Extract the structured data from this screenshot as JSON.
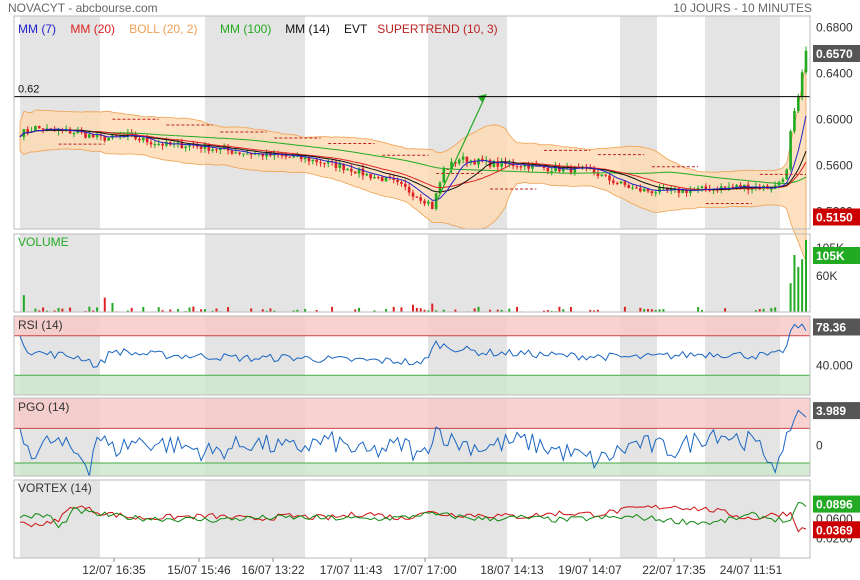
{
  "header": {
    "title": "NOVACYT - abcbourse.com",
    "period": "10 JOURS - 10 MINUTES"
  },
  "colors": {
    "mm7": "#2222cc",
    "mm20": "#dd2222",
    "boll": "#f0a050",
    "boll_fill": "#fcd9b0",
    "mm100": "#22aa22",
    "mm14": "#111111",
    "supertrend": "#bb2222",
    "weekend_band": "#e4e4e4",
    "rsi_high": "#f7c9c9",
    "rsi_low": "#cfe8cf",
    "indicator_line": "#1a66c2",
    "vortex_plus": "#118811",
    "vortex_minus": "#cc1111",
    "volume_up": "#22aa22",
    "volume_down": "#dd2222",
    "label_green": "#22aa22",
    "label_red": "#cc0000",
    "label_dark": "#555555"
  },
  "chart_data": [
    {
      "panel": "price",
      "type": "candlestick",
      "legend": [
        {
          "label": "MM (7)",
          "color": "#2222cc"
        },
        {
          "label": "MM (20)",
          "color": "#dd2222"
        },
        {
          "label": "BOLL (20, 2)",
          "color": "#f0a050"
        },
        {
          "label": "MM (100)",
          "color": "#22aa22"
        },
        {
          "label": "MM (14)",
          "color": "#111111"
        },
        {
          "label": "EVT",
          "color": "#111111"
        },
        {
          "label": "SUPERTREND (10, 3)",
          "color": "#bb2222"
        }
      ],
      "ylim": [
        0.505,
        0.69
      ],
      "yticks": [
        "0.6800",
        "0.6400",
        "0.6000",
        "0.5600",
        "0.5200"
      ],
      "hline": {
        "value": 0.62,
        "label": "0.62"
      },
      "last_label": "0.6570",
      "low_label": "0.5150",
      "close_path": [
        [
          0,
          0.588
        ],
        [
          4,
          0.593
        ],
        [
          8,
          0.59
        ],
        [
          12,
          0.59
        ],
        [
          16,
          0.588
        ],
        [
          20,
          0.584
        ],
        [
          24,
          0.584
        ],
        [
          28,
          0.586
        ],
        [
          32,
          0.582
        ],
        [
          38,
          0.578
        ],
        [
          44,
          0.578
        ],
        [
          50,
          0.575
        ],
        [
          56,
          0.572
        ],
        [
          62,
          0.57
        ],
        [
          68,
          0.568
        ],
        [
          74,
          0.566
        ],
        [
          80,
          0.562
        ],
        [
          86,
          0.557
        ],
        [
          90,
          0.552
        ],
        [
          96,
          0.547
        ],
        [
          100,
          0.54
        ],
        [
          104,
          0.532
        ],
        [
          106,
          0.528
        ],
        [
          107,
          0.524
        ],
        [
          110,
          0.556
        ],
        [
          114,
          0.566
        ],
        [
          118,
          0.564
        ],
        [
          124,
          0.561
        ],
        [
          130,
          0.561
        ],
        [
          136,
          0.558
        ],
        [
          142,
          0.557
        ],
        [
          148,
          0.556
        ],
        [
          152,
          0.549
        ],
        [
          156,
          0.544
        ],
        [
          160,
          0.539
        ],
        [
          164,
          0.538
        ],
        [
          170,
          0.538
        ],
        [
          176,
          0.539
        ],
        [
          182,
          0.541
        ],
        [
          188,
          0.542
        ],
        [
          194,
          0.541
        ],
        [
          196,
          0.542
        ],
        [
          199,
          0.555
        ],
        [
          200,
          0.588
        ],
        [
          201,
          0.605
        ],
        [
          202,
          0.618
        ],
        [
          203,
          0.64
        ],
        [
          204,
          0.657
        ]
      ],
      "bollinger_band": {
        "upper_offset": 0.012,
        "lower_offset": 0.012
      },
      "evt_arrow": {
        "from": [
          108,
          0.528
        ],
        "to": [
          121,
          0.622
        ]
      }
    },
    {
      "panel": "volume",
      "type": "bar",
      "label": "VOLUME",
      "ylim": [
        0,
        130000
      ],
      "yticks": [
        "60K"
      ],
      "top_tick": "105K",
      "last_label": "105K",
      "notable_bars": [
        {
          "x": 1,
          "value": 28000
        },
        {
          "x": 22,
          "value": 24000
        },
        {
          "x": 24,
          "value": 15000
        },
        {
          "x": 102,
          "value": 12000
        },
        {
          "x": 107,
          "value": 14000
        },
        {
          "x": 200,
          "value": 48000
        },
        {
          "x": 201,
          "value": 95000
        },
        {
          "x": 202,
          "value": 75000
        },
        {
          "x": 203,
          "value": 88000
        },
        {
          "x": 204,
          "value": 120000
        }
      ]
    },
    {
      "panel": "rsi",
      "type": "line",
      "label": "RSI (14)",
      "ylim": [
        10,
        90
      ],
      "zones": {
        "high": [
          70,
          90
        ],
        "low": [
          10,
          30
        ]
      },
      "yticks": [
        "40.000"
      ],
      "last_label": "78.36",
      "values": [
        [
          0,
          72
        ],
        [
          2,
          55
        ],
        [
          6,
          52
        ],
        [
          12,
          50
        ],
        [
          16,
          48
        ],
        [
          18,
          45
        ],
        [
          20,
          38
        ],
        [
          24,
          55
        ],
        [
          30,
          52
        ],
        [
          40,
          50
        ],
        [
          50,
          49
        ],
        [
          60,
          47
        ],
        [
          70,
          48
        ],
        [
          80,
          46
        ],
        [
          90,
          45
        ],
        [
          100,
          44
        ],
        [
          104,
          40
        ],
        [
          108,
          62
        ],
        [
          112,
          58
        ],
        [
          120,
          53
        ],
        [
          130,
          52
        ],
        [
          140,
          50
        ],
        [
          150,
          49
        ],
        [
          160,
          48
        ],
        [
          170,
          50
        ],
        [
          180,
          52
        ],
        [
          190,
          50
        ],
        [
          196,
          50
        ],
        [
          199,
          58
        ],
        [
          200,
          75
        ],
        [
          202,
          80
        ],
        [
          204,
          78
        ]
      ]
    },
    {
      "panel": "pgo",
      "type": "line",
      "label": "PGO (14)",
      "ylim": [
        -3.5,
        5.5
      ],
      "zones": {
        "high": [
          2,
          5.5
        ],
        "low": [
          -3.5,
          -2
        ]
      },
      "yticks": [
        "0"
      ],
      "last_label": "3.989",
      "values": [
        [
          0,
          0.8
        ],
        [
          4,
          -0.8
        ],
        [
          8,
          0.6
        ],
        [
          12,
          -0.2
        ],
        [
          16,
          -1.2
        ],
        [
          18,
          -2.4
        ],
        [
          20,
          1.3
        ],
        [
          24,
          -0.5
        ],
        [
          30,
          0.5
        ],
        [
          40,
          0.1
        ],
        [
          50,
          -0.8
        ],
        [
          60,
          0.4
        ],
        [
          70,
          -0.4
        ],
        [
          80,
          0.6
        ],
        [
          90,
          -0.9
        ],
        [
          100,
          0.2
        ],
        [
          104,
          -1.5
        ],
        [
          108,
          2.0
        ],
        [
          112,
          0.5
        ],
        [
          120,
          -0.2
        ],
        [
          130,
          0.6
        ],
        [
          140,
          -0.6
        ],
        [
          150,
          -1.8
        ],
        [
          160,
          0.3
        ],
        [
          170,
          -0.5
        ],
        [
          180,
          1.6
        ],
        [
          190,
          0.4
        ],
        [
          196,
          -2.0
        ],
        [
          198,
          -1.8
        ],
        [
          200,
          2.5
        ],
        [
          202,
          3.9
        ],
        [
          204,
          4.0
        ]
      ]
    },
    {
      "panel": "vortex",
      "type": "line",
      "label": "VORTEX (14)",
      "ylim": [
        -0.02,
        0.14
      ],
      "yticks": [
        "0.0600",
        "0.0200"
      ],
      "series": [
        {
          "key": "plus",
          "last_label": "0.0896",
          "values": [
            [
              0,
              0.066
            ],
            [
              8,
              0.066
            ],
            [
              10,
              0.04
            ],
            [
              14,
              0.078
            ],
            [
              20,
              0.07
            ],
            [
              30,
              0.062
            ],
            [
              40,
              0.06
            ],
            [
              50,
              0.058
            ],
            [
              60,
              0.062
            ],
            [
              70,
              0.063
            ],
            [
              80,
              0.062
            ],
            [
              90,
              0.06
            ],
            [
              100,
              0.063
            ],
            [
              104,
              0.07
            ],
            [
              110,
              0.068
            ],
            [
              120,
              0.06
            ],
            [
              130,
              0.063
            ],
            [
              140,
              0.058
            ],
            [
              150,
              0.062
            ],
            [
              160,
              0.064
            ],
            [
              170,
              0.056
            ],
            [
              180,
              0.052
            ],
            [
              190,
              0.068
            ],
            [
              196,
              0.06
            ],
            [
              200,
              0.055
            ],
            [
              202,
              0.088
            ],
            [
              204,
              0.09
            ]
          ]
        },
        {
          "key": "minus",
          "last_label": "0.0369",
          "values": [
            [
              0,
              0.05
            ],
            [
              8,
              0.05
            ],
            [
              10,
              0.06
            ],
            [
              14,
              0.088
            ],
            [
              20,
              0.075
            ],
            [
              30,
              0.062
            ],
            [
              40,
              0.064
            ],
            [
              50,
              0.066
            ],
            [
              60,
              0.06
            ],
            [
              70,
              0.066
            ],
            [
              80,
              0.062
            ],
            [
              90,
              0.072
            ],
            [
              100,
              0.06
            ],
            [
              104,
              0.075
            ],
            [
              110,
              0.07
            ],
            [
              120,
              0.068
            ],
            [
              130,
              0.065
            ],
            [
              140,
              0.072
            ],
            [
              150,
              0.07
            ],
            [
              160,
              0.082
            ],
            [
              170,
              0.086
            ],
            [
              180,
              0.078
            ],
            [
              190,
              0.06
            ],
            [
              196,
              0.07
            ],
            [
              200,
              0.072
            ],
            [
              202,
              0.04
            ],
            [
              204,
              0.037
            ]
          ]
        }
      ]
    }
  ],
  "x_axis": {
    "ticks": [
      "12/07 16:35",
      "15/07 15:46",
      "16/07 13:22",
      "17/07 11:43",
      "17/07 17:00",
      "18/07 14:13",
      "19/07 14:07",
      "22/07 17:35",
      "24/07 11:51"
    ]
  }
}
